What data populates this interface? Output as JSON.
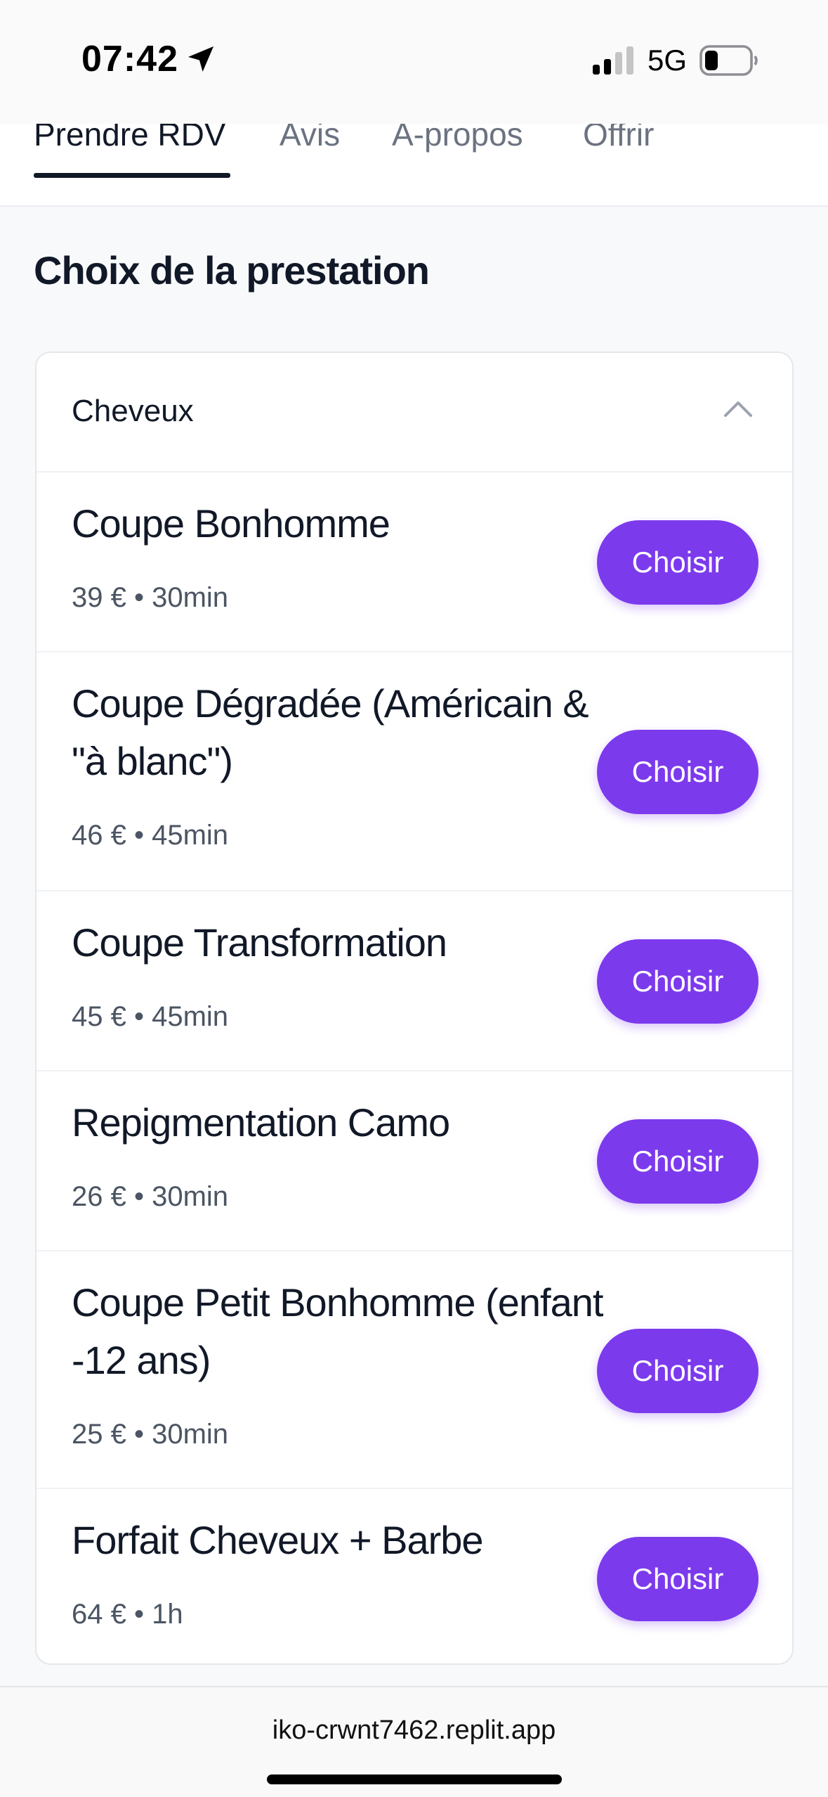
{
  "status_bar": {
    "time": "07:42",
    "network": "5G",
    "icons": [
      "location-arrow-icon",
      "signal-icon",
      "battery-icon"
    ]
  },
  "tabs": [
    {
      "label": "Prendre RDV",
      "active": true
    },
    {
      "label": "Avis",
      "active": false
    },
    {
      "label": "A-propos",
      "active": false
    },
    {
      "label": "Offrir",
      "active": false
    }
  ],
  "main": {
    "section_title": "Choix de la prestation",
    "category": {
      "label": "Cheveux",
      "expanded": true,
      "icon": "chevron-up-icon"
    },
    "services": [
      {
        "name": "Coupe Bonhomme",
        "meta": "39 € • 30min",
        "button_label": "Choisir"
      },
      {
        "name": "Coupe Dégradée (Américain & \"à blanc\")",
        "meta": "46 € • 45min",
        "button_label": "Choisir"
      },
      {
        "name": "Coupe Transformation",
        "meta": "45 € • 45min",
        "button_label": "Choisir"
      },
      {
        "name": "Repigmentation Camo",
        "meta": "26 € • 30min",
        "button_label": "Choisir"
      },
      {
        "name": "Coupe Petit Bonhomme (enfant -12 ans)",
        "meta": "25 € • 30min",
        "button_label": "Choisir"
      },
      {
        "name": "Forfait Cheveux + Barbe",
        "meta": "64 € • 1h",
        "button_label": "Choisir"
      }
    ]
  },
  "browser": {
    "url": "iko-crwnt7462.replit.app"
  },
  "colors": {
    "accent": "#7c3aed",
    "text_primary": "#111827",
    "text_secondary": "#6b7280",
    "background": "#f8f9fb"
  }
}
